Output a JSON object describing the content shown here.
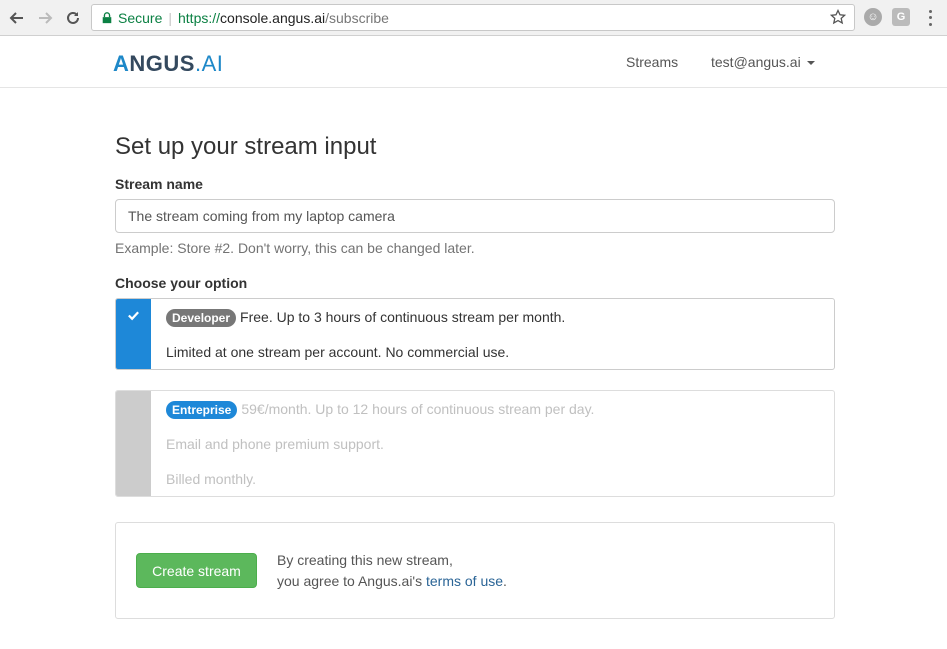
{
  "browser": {
    "secure_label": "Secure",
    "url_scheme": "https://",
    "url_host": "console.angus.ai",
    "url_path": "/subscribe"
  },
  "navbar": {
    "logo_a": "A",
    "logo_ngus": "NGUS",
    "logo_ai": ".AI",
    "streams_link": "Streams",
    "user_menu": "test@angus.ai"
  },
  "form": {
    "title": "Set up your stream input",
    "stream_name_label": "Stream name",
    "stream_name_value": "The stream coming from my laptop camera",
    "stream_name_help": "Example: Store #2. Don't worry, this can be changed later.",
    "option_label": "Choose your option"
  },
  "options": [
    {
      "badge": "Developer",
      "line1": "Free. Up to 3 hours of continuous stream per month.",
      "line2": "Limited at one stream per account. No commercial use.",
      "selected": true,
      "badge_color": "#777777",
      "accent_color": "#1e88d8"
    },
    {
      "badge": "Entreprise",
      "line1": "59€/month. Up to 12 hours of continuous stream per day.",
      "line2": "Email and phone premium support.",
      "line3": "Billed monthly.",
      "selected": false,
      "badge_color": "#1e88d8",
      "accent_color": "#cccccc"
    }
  ],
  "submit": {
    "button_label": "Create stream",
    "agree_line1": "By creating this new stream,",
    "agree_prefix": "you agree to Angus.ai's ",
    "terms_link": "terms of use",
    "agree_suffix": "."
  }
}
